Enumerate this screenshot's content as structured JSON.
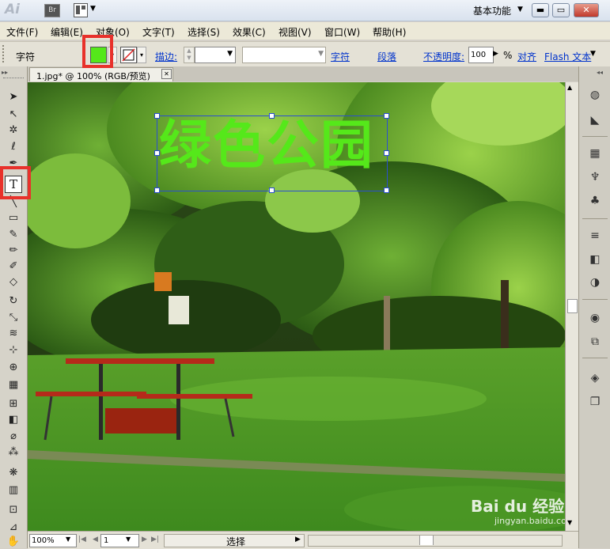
{
  "app": {
    "logo": "Ai",
    "bridge_button": "Br",
    "workspace": "基本功能"
  },
  "window_buttons": {
    "minimize": "▬",
    "restore": "▭",
    "close": "✕"
  },
  "menu": {
    "items": [
      "文件(F)",
      "编辑(E)",
      "对象(O)",
      "文字(T)",
      "选择(S)",
      "效果(C)",
      "视图(V)",
      "窗口(W)",
      "帮助(H)"
    ]
  },
  "control_bar": {
    "label": "字符",
    "fill_color": "#55e81a",
    "stroke_label": "描边:",
    "font_name_value": "",
    "char_link": "字符",
    "para_link": "段落",
    "opacity_label": "不透明度:",
    "opacity_value": "100",
    "percent": "%",
    "align_link": "对齐",
    "flash_link": "Flash 文本"
  },
  "document": {
    "tab_label": "1.jpg* @ 100% (RGB/预览)",
    "tab_close": "✕",
    "headline_text": "绿色公园",
    "headline_color": "#55e81a"
  },
  "status": {
    "zoom": "100%",
    "artboard": "1",
    "tool_state": "选择"
  },
  "watermark": {
    "brand": "Bai du 经验",
    "url": "jingyan.baidu.com"
  },
  "highlight_color": "#e8312b"
}
